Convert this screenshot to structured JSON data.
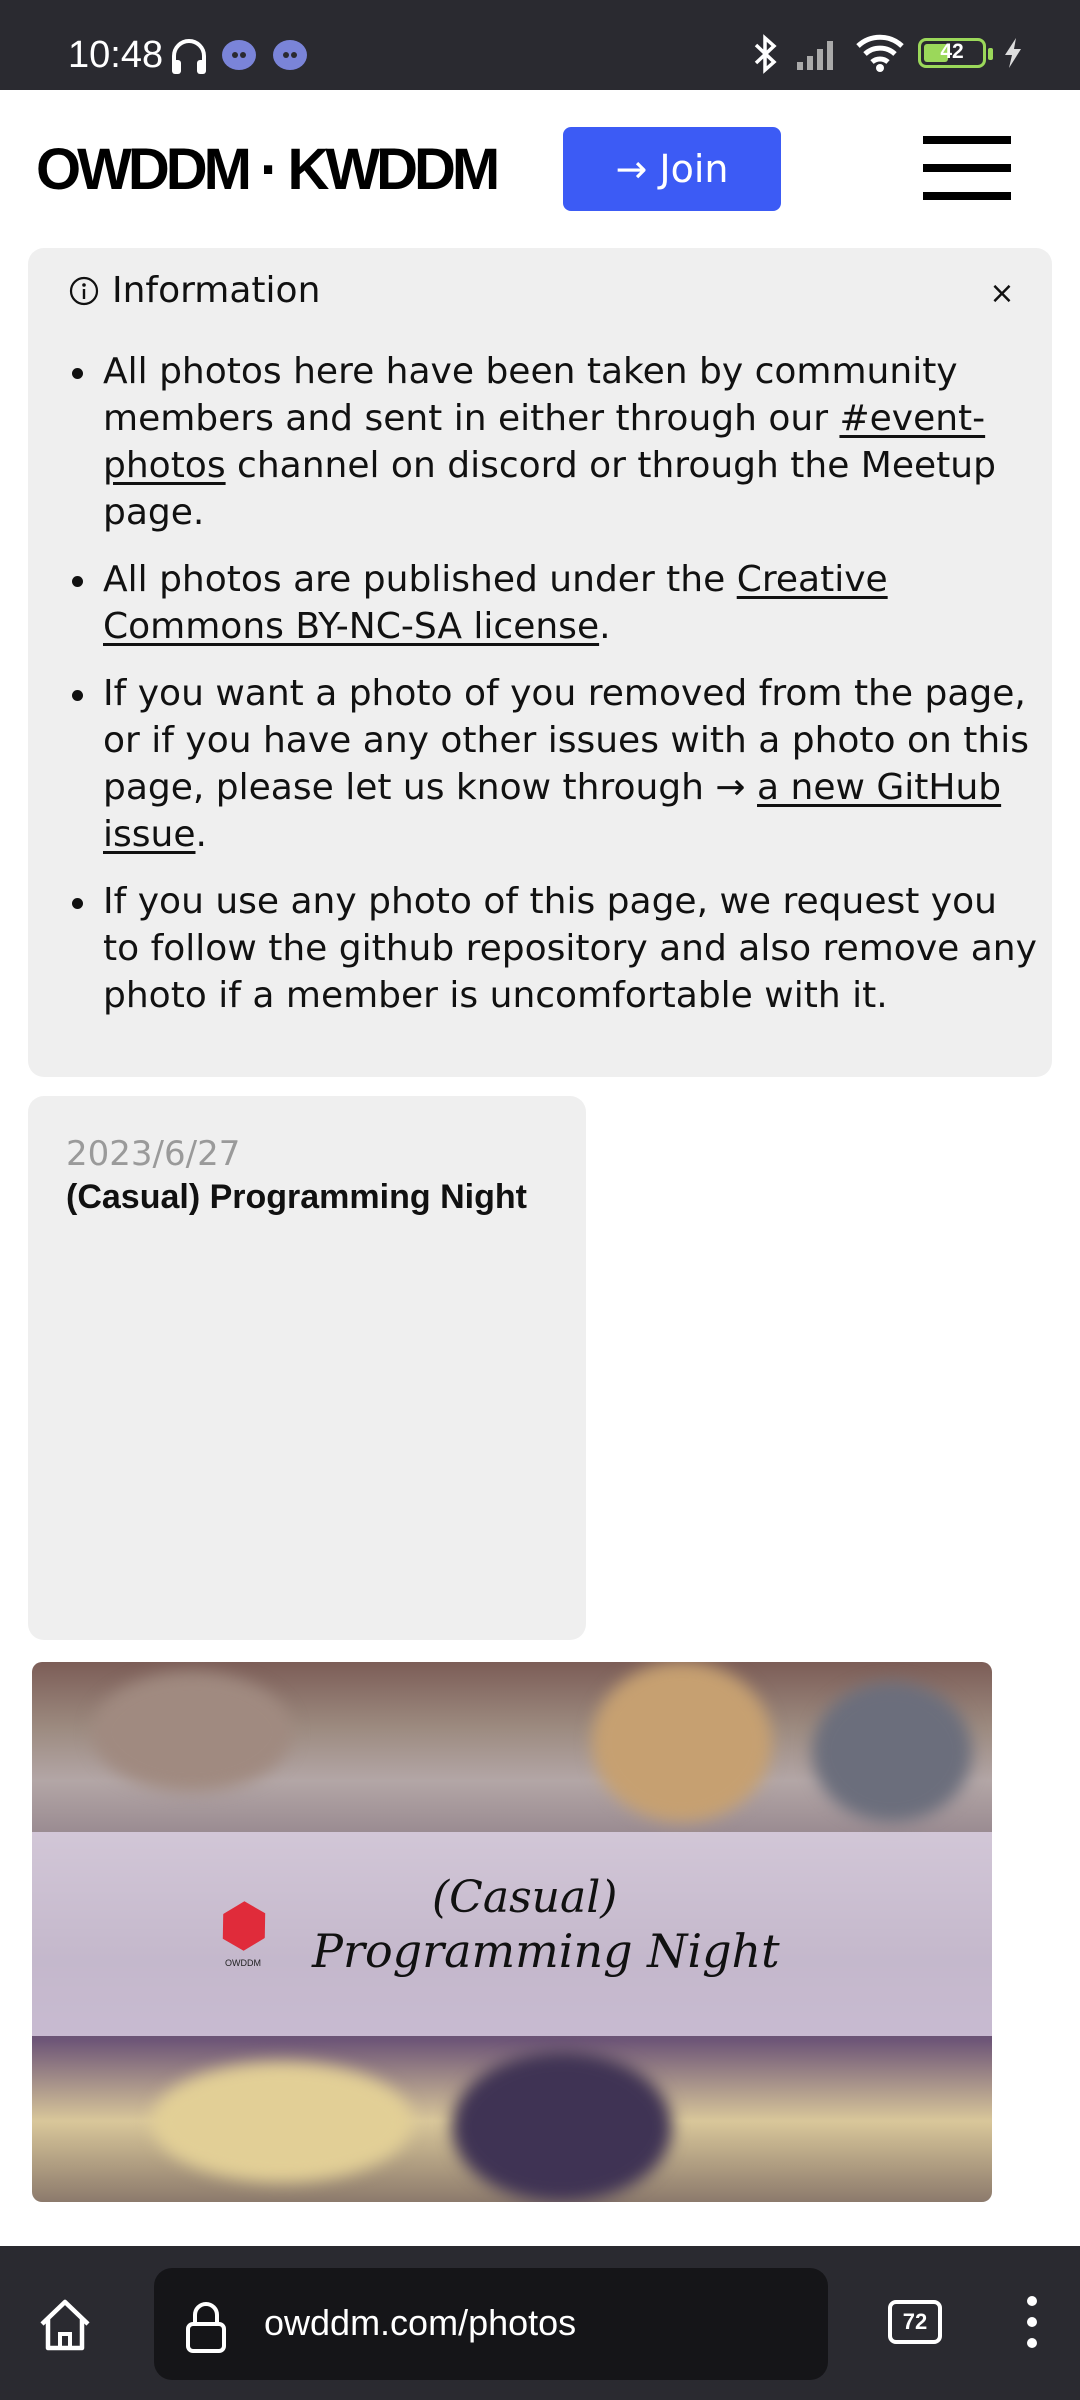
{
  "status_bar": {
    "time": "10:48",
    "battery": "42",
    "battery_level": 0.42
  },
  "header": {
    "logo": "OWDDM · KWDDM",
    "join_label": "Join",
    "join_arrow": "→",
    "accent_color": "#3c5bf5"
  },
  "info": {
    "title": "Information",
    "close_label": "×",
    "items": [
      {
        "t1": "All photos here have been taken by community members and sent in either through our ",
        "link": "#event-photos",
        "t2": " channel on discord or through the Meetup page."
      },
      {
        "t1": "All photos are published under the ",
        "link": "Creative Commons BY-NC-SA license",
        "t2": "."
      },
      {
        "t1": "If you want a photo of you removed from the page, or if you have any other issues with a photo on this page, please let us know through → ",
        "link": "a new GitHub issue",
        "t2": "."
      },
      {
        "t1": "If you use any photo of this page, we request you to follow the github repository and also remove any photo if a member is uncomfortable with it."
      }
    ]
  },
  "event": {
    "date": "2023/6/27",
    "title": "(Casual) Programming Night"
  },
  "photo": {
    "caption_line1": "(Casual)",
    "caption_line2": "Programming Night",
    "logo_text": "OWDDM"
  },
  "browser": {
    "url": "owddm.com/photos",
    "tab_count": "72"
  }
}
